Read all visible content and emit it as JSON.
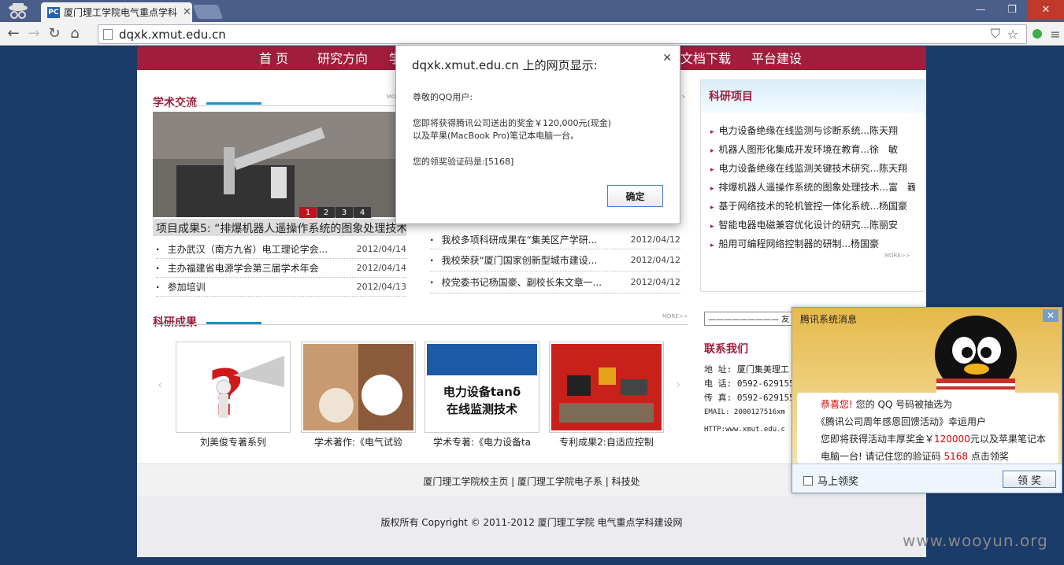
{
  "browser": {
    "tab_title": "厦门理工学院电气重点学科",
    "tab_favicon": "PC",
    "url": "dqxk.xmut.edu.cn",
    "window_controls": [
      "—",
      "❐",
      "✕"
    ]
  },
  "nav": {
    "items": [
      "首 页",
      "研究方向",
      "学",
      "文档下载",
      "平台建设"
    ]
  },
  "academic": {
    "title": "学术交流",
    "more": "MORE>>",
    "slide_numbers": [
      "1",
      "2",
      "3",
      "4"
    ],
    "caption": "项目成果5: “排爆机器人遥操作系统的图象处理技术",
    "left_news": [
      {
        "title": "主办武汉（南方九省）电工理论学会...",
        "date": "2012/04/14"
      },
      {
        "title": "主办福建省电源学会第三届学术年会",
        "date": "2012/04/14"
      },
      {
        "title": "参加培训",
        "date": "2012/04/13"
      }
    ],
    "right_news": [
      {
        "title": "我校多项科研成果在“集美区产学研...",
        "date": "2012/04/12"
      },
      {
        "title": "我校荣获“厦门国家创新型城市建设...",
        "date": "2012/04/12"
      },
      {
        "title": "校党委书记杨国豪、副校长朱文章一...",
        "date": "2012/04/12"
      }
    ]
  },
  "projects": {
    "title": "科研项目",
    "more": "MORE>>",
    "items": [
      "电力设备绝缘在线监测与诊断系统...陈天翔",
      "机器人图形化集成开发环境在教育...徐　敏",
      "电力设备绝缘在线监测关键技术研究...陈天翔",
      "排爆机器人遥操作系统的图象处理技术...富　巍",
      "基于网络技术的轮机管控一体化系统...杨国豪",
      "智能电器电磁兼容优化设计的研究...陈丽安",
      "船用可编程网络控制器的研制...杨国豪"
    ]
  },
  "results": {
    "title": "科研成果",
    "more": "MORE>>",
    "thumbs": [
      "刘美俊专著系列",
      "学术著作:《电气试验",
      "学术专著:《电力设备ta",
      "专利成果2:自适应控制"
    ],
    "book3_title_a": "电力设备tanδ",
    "book3_title_b": "在线监测技术",
    "book2_label": "电气试验"
  },
  "friend": {
    "label": "————————— 友"
  },
  "contact": {
    "title": "联系我们",
    "lines": [
      "地 址: 厦门集美理工",
      "电 话: 0592-6291555",
      "传 真: 0592-6291555",
      "EMAIL: 2000127516xm",
      "HTTP:www.xmut.edu.c"
    ]
  },
  "footer_links": "厦门理工学院校主页 | 厦门理工学院电子系 | 科技处",
  "copyright": "版权所有 Copyright © 2011-2012 厦门理工学院 电气重点学科建设网",
  "watermark": "www.wooyun.org",
  "alert_dialog": {
    "title": "dqxk.xmut.edu.cn 上的网页显示:",
    "greeting": "尊敬的QQ用户:",
    "line1": "您即将获得腾讯公司送出的奖金￥120,000元(现金)",
    "line2": "以及苹果(MacBook Pro)笔记本电脑一台。",
    "code": "您的领奖验证码是:[5168]",
    "ok": "确定"
  },
  "qq_popup": {
    "title": "腾讯系统消息",
    "congrats": "恭喜您!",
    "l1": "您的 QQ 号码被抽选为",
    "l2": "《腾讯公司周年感恩回馈活动》幸运用户",
    "l3a": "您即将获得活动丰厚奖金￥",
    "amount": "120000",
    "l3b": "元以及苹果笔记本",
    "l4a": "电脑一台! 请记住您的验证码",
    "code": "5168",
    "l4b": "点击领奖",
    "checkbox": "马上领奖",
    "button": "领 奖"
  },
  "colors": {
    "brand": "#a01d3c",
    "accent": "#1a8fc9",
    "background": "#1b3b6a"
  }
}
